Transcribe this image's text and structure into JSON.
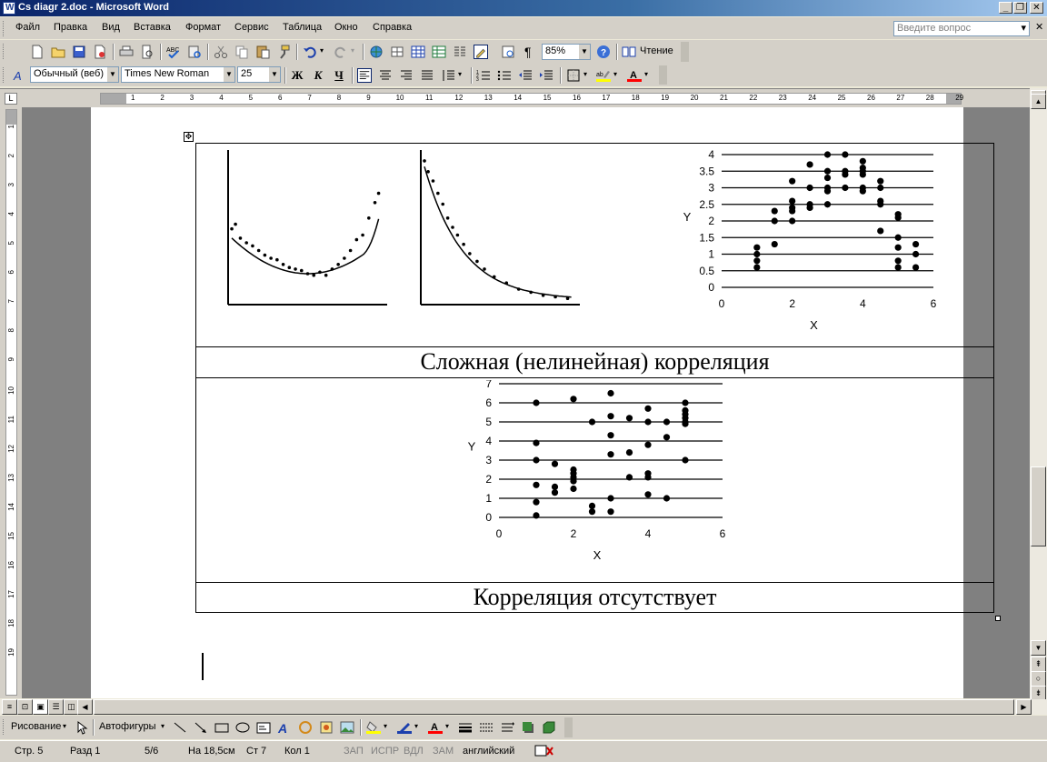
{
  "window": {
    "title": "Cs diagr 2.doc - Microsoft Word",
    "buttons": [
      "_",
      "❐",
      "✕"
    ]
  },
  "menu": {
    "items": [
      "Файл",
      "Правка",
      "Вид",
      "Вставка",
      "Формат",
      "Сервис",
      "Таблица",
      "Окно",
      "Справка"
    ],
    "ask_placeholder": "Введите вопрос",
    "close_doc": "✕"
  },
  "standard_toolbar": {
    "zoom": "85%",
    "reading_label": "Чтение"
  },
  "formatting_toolbar": {
    "style": "Обычный (веб)",
    "font": "Times New Roman",
    "size": "25",
    "bold": "Ж",
    "italic": "К",
    "underline": "Ч"
  },
  "ruler": {
    "ticks": [
      "1",
      "2",
      "3",
      "4",
      "5",
      "6",
      "7",
      "8",
      "9",
      "10",
      "11",
      "12",
      "13",
      "14",
      "15",
      "16",
      "17",
      "18",
      "19",
      "20",
      "21",
      "22",
      "23",
      "24",
      "25",
      "26",
      "27",
      "28",
      "29"
    ],
    "vticks": [
      "1",
      "2",
      "3",
      "4",
      "5",
      "6",
      "7",
      "8",
      "9",
      "10",
      "11",
      "12",
      "13",
      "14",
      "15",
      "16",
      "17",
      "18",
      "19"
    ]
  },
  "document": {
    "captions": {
      "complex": "Сложная (нелинейная) корреляция",
      "none": "Корреляция отсутствует"
    }
  },
  "chart_data": [
    {
      "type": "scatter",
      "title": "",
      "xlabel": "",
      "ylabel": "",
      "points": [
        [
          0.3,
          4.9
        ],
        [
          0.6,
          5.2
        ],
        [
          1.0,
          4.3
        ],
        [
          1.5,
          4.0
        ],
        [
          2.0,
          3.8
        ],
        [
          2.5,
          3.5
        ],
        [
          3.0,
          3.2
        ],
        [
          3.5,
          3.0
        ],
        [
          4.0,
          2.9
        ],
        [
          4.5,
          2.6
        ],
        [
          5.0,
          2.4
        ],
        [
          5.5,
          2.3
        ],
        [
          6.0,
          2.2
        ],
        [
          6.5,
          2.0
        ],
        [
          7.0,
          1.9
        ],
        [
          7.5,
          2.1
        ],
        [
          8.0,
          1.9
        ],
        [
          8.5,
          2.3
        ],
        [
          9.0,
          2.6
        ],
        [
          9.5,
          3.0
        ],
        [
          10.0,
          3.5
        ],
        [
          10.5,
          4.2
        ],
        [
          11.0,
          4.5
        ],
        [
          11.5,
          5.6
        ],
        [
          12.0,
          6.6
        ],
        [
          12.3,
          7.2
        ]
      ],
      "trend": "U-shaped curve"
    },
    {
      "type": "scatter",
      "title": "",
      "xlabel": "",
      "ylabel": "",
      "points": [
        [
          0.3,
          9.3
        ],
        [
          0.6,
          8.6
        ],
        [
          1.0,
          8.0
        ],
        [
          1.4,
          7.2
        ],
        [
          1.8,
          6.5
        ],
        [
          2.2,
          5.6
        ],
        [
          2.6,
          5.0
        ],
        [
          3.0,
          4.5
        ],
        [
          3.5,
          3.9
        ],
        [
          4.0,
          3.3
        ],
        [
          4.6,
          2.8
        ],
        [
          5.2,
          2.3
        ],
        [
          6.0,
          1.8
        ],
        [
          7.0,
          1.4
        ],
        [
          8.0,
          1.0
        ],
        [
          9.0,
          0.8
        ],
        [
          10.0,
          0.6
        ],
        [
          11.0,
          0.5
        ],
        [
          12.0,
          0.4
        ]
      ],
      "trend": "exponential decay curve"
    },
    {
      "type": "scatter",
      "xlabel": "X",
      "ylabel": "Y",
      "xlim": [
        0,
        6
      ],
      "ylim": [
        0,
        4
      ],
      "xticks": [
        "0",
        "2",
        "4",
        "6"
      ],
      "yticks": [
        "0",
        "0.5",
        "1",
        "1.5",
        "2",
        "2.5",
        "3",
        "3.5",
        "4"
      ],
      "grid": "horizontal",
      "points": [
        [
          1,
          0.6
        ],
        [
          1,
          0.8
        ],
        [
          1,
          1.0
        ],
        [
          1,
          1.2
        ],
        [
          1.5,
          1.3
        ],
        [
          1.5,
          2.0
        ],
        [
          1.5,
          2.3
        ],
        [
          2,
          2.0
        ],
        [
          2,
          2.3
        ],
        [
          2,
          2.4
        ],
        [
          2,
          2.6
        ],
        [
          2,
          3.2
        ],
        [
          2.5,
          2.4
        ],
        [
          2.5,
          2.5
        ],
        [
          2.5,
          3.0
        ],
        [
          2.5,
          3.7
        ],
        [
          3,
          2.5
        ],
        [
          3,
          2.9
        ],
        [
          3,
          3.0
        ],
        [
          3,
          3.3
        ],
        [
          3,
          3.5
        ],
        [
          3,
          4.0
        ],
        [
          3.5,
          3.0
        ],
        [
          3.5,
          3.4
        ],
        [
          3.5,
          3.5
        ],
        [
          3.5,
          4.0
        ],
        [
          4,
          2.9
        ],
        [
          4,
          3.0
        ],
        [
          4,
          3.4
        ],
        [
          4,
          3.5
        ],
        [
          4,
          3.6
        ],
        [
          4,
          3.8
        ],
        [
          4.5,
          1.7
        ],
        [
          4.5,
          2.5
        ],
        [
          4.5,
          2.6
        ],
        [
          4.5,
          3.0
        ],
        [
          4.5,
          3.2
        ],
        [
          5,
          0.6
        ],
        [
          5,
          0.8
        ],
        [
          5,
          1.2
        ],
        [
          5,
          1.5
        ],
        [
          5,
          2.1
        ],
        [
          5,
          2.2
        ],
        [
          5.5,
          0.6
        ],
        [
          5.5,
          1.0
        ],
        [
          5.5,
          1.3
        ]
      ]
    },
    {
      "type": "scatter",
      "xlabel": "X",
      "ylabel": "Y",
      "xlim": [
        0,
        6
      ],
      "ylim": [
        0,
        7
      ],
      "xticks": [
        "0",
        "2",
        "4",
        "6"
      ],
      "yticks": [
        "0",
        "1",
        "2",
        "3",
        "4",
        "5",
        "6",
        "7"
      ],
      "grid": "horizontal",
      "points": [
        [
          1,
          0.1
        ],
        [
          1,
          0.8
        ],
        [
          1,
          1.7
        ],
        [
          1,
          3.0
        ],
        [
          1,
          3.9
        ],
        [
          1,
          6.0
        ],
        [
          1.5,
          1.3
        ],
        [
          1.5,
          1.6
        ],
        [
          1.5,
          2.8
        ],
        [
          2,
          1.5
        ],
        [
          2,
          1.9
        ],
        [
          2,
          2.1
        ],
        [
          2,
          2.3
        ],
        [
          2,
          2.5
        ],
        [
          2,
          6.2
        ],
        [
          2.5,
          0.3
        ],
        [
          2.5,
          0.6
        ],
        [
          2.5,
          5.0
        ],
        [
          3,
          0.3
        ],
        [
          3,
          1.0
        ],
        [
          3,
          3.3
        ],
        [
          3,
          4.3
        ],
        [
          3,
          5.3
        ],
        [
          3,
          6.5
        ],
        [
          3.5,
          2.1
        ],
        [
          3.5,
          3.4
        ],
        [
          3.5,
          5.2
        ],
        [
          4,
          1.2
        ],
        [
          4,
          2.1
        ],
        [
          4,
          2.3
        ],
        [
          4,
          3.8
        ],
        [
          4,
          5.0
        ],
        [
          4,
          5.7
        ],
        [
          4.5,
          1.0
        ],
        [
          4.5,
          4.2
        ],
        [
          4.5,
          5.0
        ],
        [
          5,
          3.0
        ],
        [
          5,
          4.9
        ],
        [
          5,
          5.0
        ],
        [
          5,
          5.2
        ],
        [
          5,
          5.4
        ],
        [
          5,
          5.6
        ],
        [
          5,
          6.0
        ]
      ]
    }
  ],
  "status": {
    "page": "Стр. 5",
    "section": "Разд 1",
    "pages": "5/6",
    "at": "На 18,5см",
    "line": "Ст 7",
    "col": "Кол 1",
    "rec": "ЗАП",
    "trk": "ИСПР",
    "ext": "ВДЛ",
    "ovr": "ЗАМ",
    "lang": "английский"
  },
  "drawing_toolbar": {
    "draw_label": "Рисование",
    "autoshapes_label": "Автофигуры"
  },
  "colors": {
    "titlebar": "#0a246a",
    "chrome": "#d4d0c8",
    "doc_background": "#808080"
  }
}
